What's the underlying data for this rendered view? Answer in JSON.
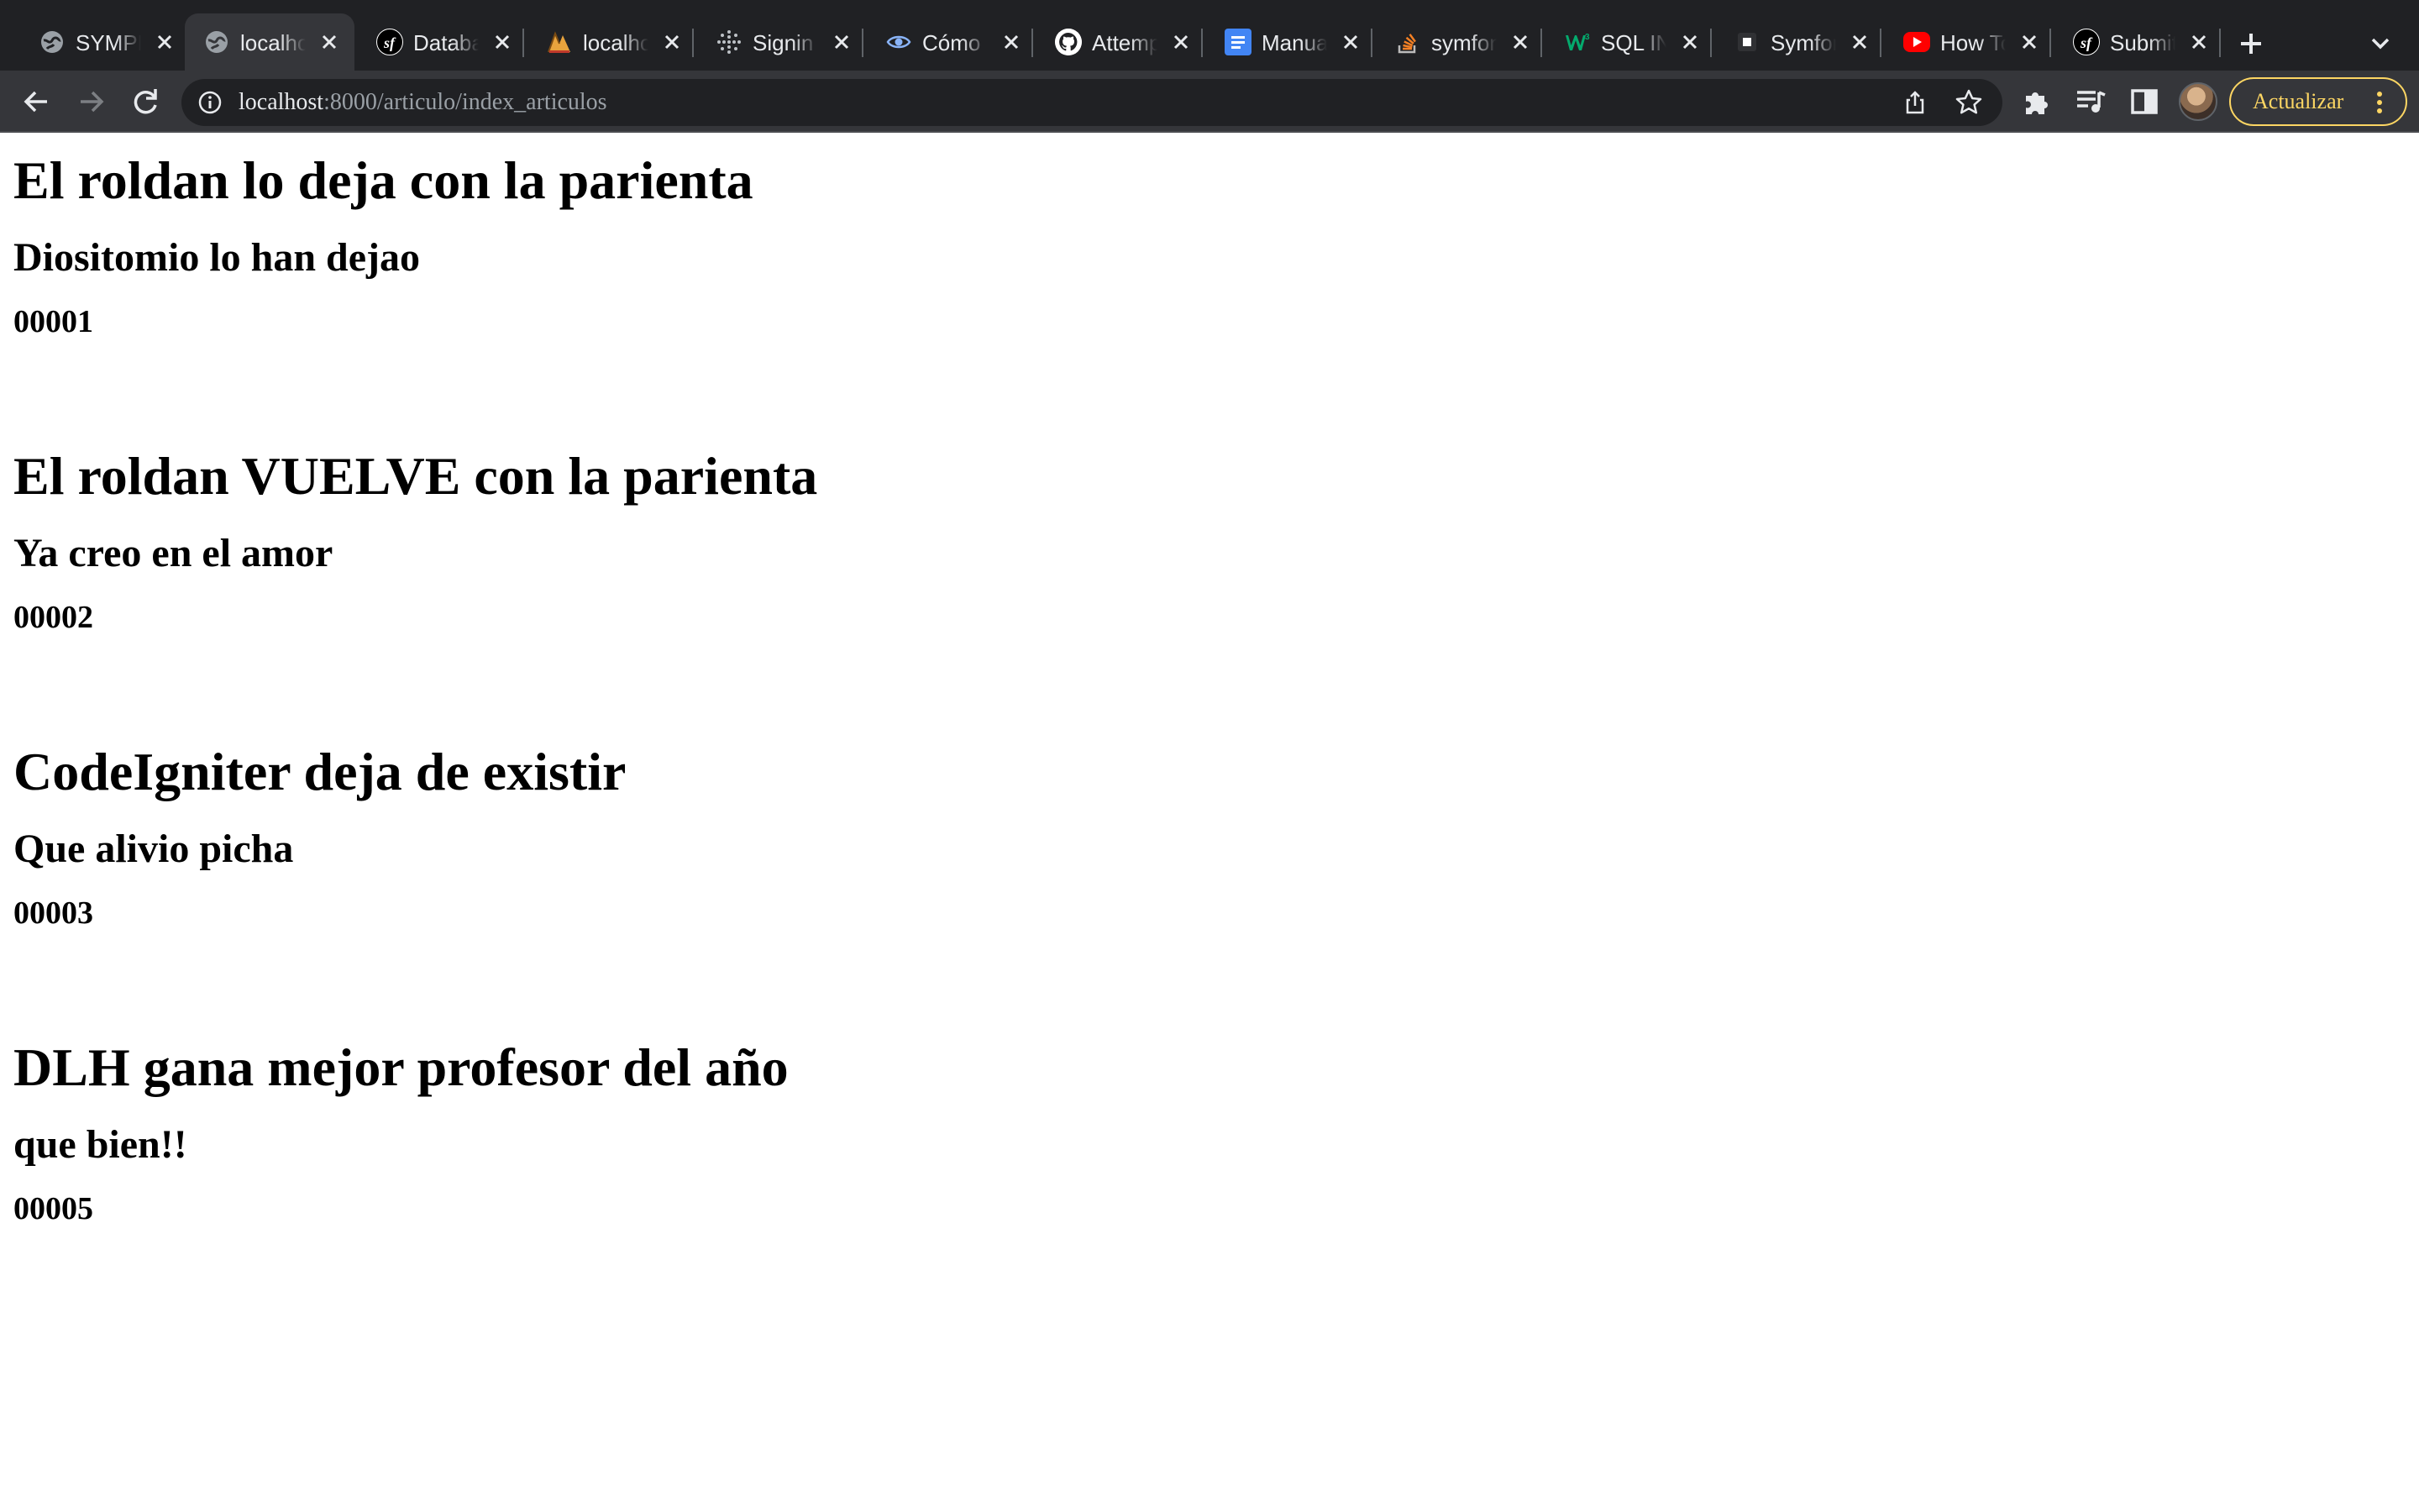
{
  "browser": {
    "tabs": [
      {
        "title": "SYMPHONY",
        "icon": "globe-icon",
        "active": false
      },
      {
        "title": "localhost",
        "icon": "globe-icon",
        "active": true
      },
      {
        "title": "Database",
        "icon": "symfony-icon",
        "active": false
      },
      {
        "title": "localhost",
        "icon": "phpmyadmin-icon",
        "active": false
      },
      {
        "title": "Signin",
        "icon": "dots-icon",
        "active": false
      },
      {
        "title": "Cómo",
        "icon": "eye-icon",
        "active": false
      },
      {
        "title": "Attempt",
        "icon": "github-icon",
        "active": false
      },
      {
        "title": "Manual",
        "icon": "docs-icon",
        "active": false
      },
      {
        "title": "symfony",
        "icon": "stackoverflow-icon",
        "active": false
      },
      {
        "title": "SQL IN",
        "icon": "w3schools-icon",
        "active": false
      },
      {
        "title": "Symfony",
        "icon": "square-icon",
        "active": false
      },
      {
        "title": "How To",
        "icon": "youtube-icon",
        "active": false
      },
      {
        "title": "Submit",
        "icon": "symfony-icon",
        "active": false
      }
    ],
    "url": {
      "host": "localhost",
      "path": ":8000/articulo/index_articulos"
    },
    "update_label": "Actualizar"
  },
  "articles": [
    {
      "titulo": "El roldan lo deja con la parienta",
      "subtitulo": "Diositomio lo han dejao",
      "codigo": "00001"
    },
    {
      "titulo": "El roldan VUELVE con la parienta",
      "subtitulo": "Ya creo en el amor",
      "codigo": "00002"
    },
    {
      "titulo": "CodeIgniter deja de existir",
      "subtitulo": "Que alivio picha",
      "codigo": "00003"
    },
    {
      "titulo": "DLH gana mejor profesor del año",
      "subtitulo": "que bien!!",
      "codigo": "00005"
    }
  ]
}
